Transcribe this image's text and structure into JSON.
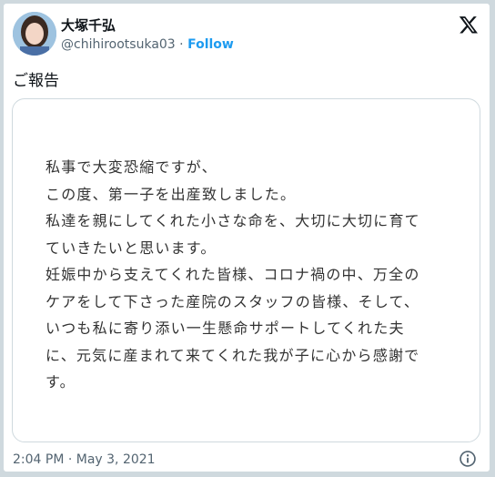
{
  "author": {
    "name": "大塚千弘",
    "handle": "@chihirootsuka03",
    "separator": "·",
    "follow_label": "Follow"
  },
  "tweet": {
    "text": "ご報告",
    "timestamp": "2:04 PM · May 3, 2021"
  },
  "media": {
    "lines": [
      "私事で大変恐縮ですが、",
      "この度、第一子を出産致しました。",
      "私達を親にしてくれた小さな命を、大切に大切に育て",
      "ていきたいと思います。",
      "妊娠中から支えてくれた皆様、コロナ禍の中、万全の",
      "ケアをして下さった産院のスタッフの皆様、そして、",
      "いつも私に寄り添い一生懸命サポートしてくれた夫",
      "に、元気に産まれて来てくれた我が子に心から感謝で",
      "す。"
    ]
  },
  "icons": {
    "logo": "x-logo-icon",
    "info": "info-icon",
    "avatar": "avatar"
  },
  "colors": {
    "link": "#1d9bf0",
    "secondary_text": "#536471",
    "border": "#cfd9de"
  }
}
